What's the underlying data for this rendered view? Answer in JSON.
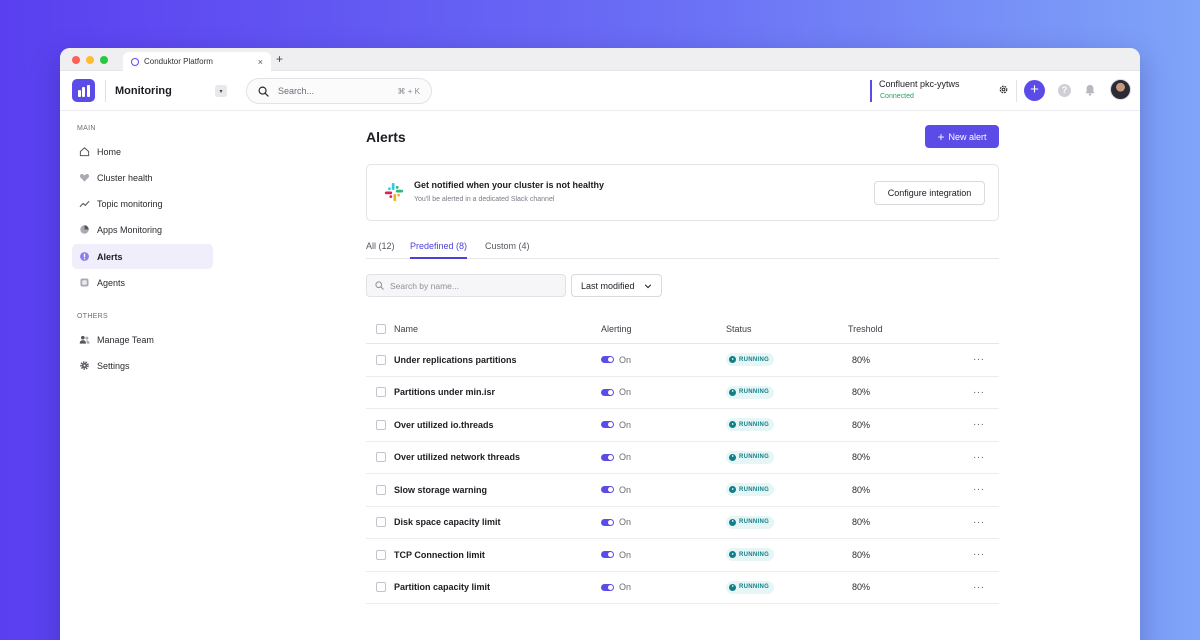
{
  "browser": {
    "tab_title": "Conduktor Platform",
    "tab_close": "×",
    "new_tab": "+"
  },
  "header": {
    "module_title": "Monitoring",
    "module_caret": "▾",
    "search_placeholder": "Search...",
    "search_shortcut": "⌘ + K",
    "cluster_name": "Confluent pkc-yytws",
    "cluster_status": "Connected",
    "plus_label": "+",
    "help_label": "?"
  },
  "sidebar": {
    "main_label": "MAIN",
    "main_items": [
      {
        "label": "Home",
        "icon": "home-icon"
      },
      {
        "label": "Cluster health",
        "icon": "heart-icon"
      },
      {
        "label": "Topic monitoring",
        "icon": "trend-icon"
      },
      {
        "label": "Apps Monitoring",
        "icon": "pie-icon"
      },
      {
        "label": "Alerts",
        "icon": "alert-icon",
        "active": true
      },
      {
        "label": "Agents",
        "icon": "agent-icon"
      }
    ],
    "others_label": "OTHERS",
    "other_items": [
      {
        "label": "Manage Team",
        "icon": "team-icon"
      },
      {
        "label": "Settings",
        "icon": "gear-icon"
      }
    ]
  },
  "main": {
    "title": "Alerts",
    "new_alert_label": "New alert",
    "banner": {
      "title": "Get notified when your cluster is not healthy",
      "subtitle": "You'll be alerted in a dedicated Slack channel",
      "button": "Configure integration"
    },
    "tabs": [
      {
        "label": "All (12)"
      },
      {
        "label": "Predefined (8)",
        "active": true
      },
      {
        "label": "Custom (4)"
      }
    ],
    "search_placeholder": "Search by name...",
    "sort_label": "Last modified",
    "table": {
      "headers": {
        "name": "Name",
        "alerting": "Alerting",
        "status": "Status",
        "threshold": "Treshold"
      },
      "rows": [
        {
          "name": "Under replications partitions",
          "alerting": "On",
          "status": "RUNNING",
          "threshold": "80%"
        },
        {
          "name": "Partitions under min.isr",
          "alerting": "On",
          "status": "RUNNING",
          "threshold": "80%"
        },
        {
          "name": "Over utilized io.threads",
          "alerting": "On",
          "status": "RUNNING",
          "threshold": "80%"
        },
        {
          "name": "Over utilized network threads",
          "alerting": "On",
          "status": "RUNNING",
          "threshold": "80%"
        },
        {
          "name": "Slow storage warning",
          "alerting": "On",
          "status": "RUNNING",
          "threshold": "80%"
        },
        {
          "name": "Disk space capacity limit",
          "alerting": "On",
          "status": "RUNNING",
          "threshold": "80%"
        },
        {
          "name": "TCP Connection limit",
          "alerting": "On",
          "status": "RUNNING",
          "threshold": "80%"
        },
        {
          "name": "Partition capacity limit",
          "alerting": "On",
          "status": "RUNNING",
          "threshold": "80%"
        }
      ],
      "more_label": "···"
    }
  },
  "colors": {
    "accent": "#5b4ce8",
    "running": "#127f86",
    "connected": "#23a35a"
  }
}
